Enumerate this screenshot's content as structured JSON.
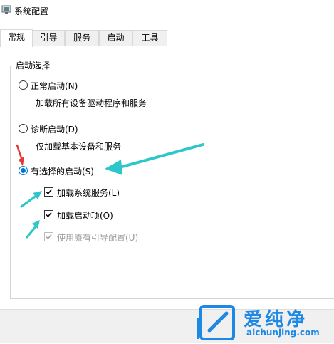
{
  "window": {
    "title": "系统配置",
    "icon": "msconfig-icon"
  },
  "tabs": [
    {
      "label": "常规",
      "active": true
    },
    {
      "label": "引导",
      "active": false
    },
    {
      "label": "服务",
      "active": false
    },
    {
      "label": "启动",
      "active": false
    },
    {
      "label": "工具",
      "active": false
    }
  ],
  "startup": {
    "group_label": "启动选择",
    "normal": {
      "label": "正常启动(N)",
      "desc": "加载所有设备驱动程序和服务",
      "selected": false
    },
    "diagnostic": {
      "label": "诊断启动(D)",
      "desc": "仅加载基本设备和服务",
      "selected": false
    },
    "selective": {
      "label": "有选择的启动(S)",
      "selected": true,
      "load_services": {
        "label": "加载系统服务(L)",
        "checked": true
      },
      "load_startup": {
        "label": "加载启动项(O)",
        "checked": true
      },
      "use_original_boot": {
        "label": "使用原有引导配置(U)",
        "checked": true,
        "disabled": true
      }
    }
  },
  "watermark": {
    "brand": "爱纯净",
    "url": "aichunjing.com"
  },
  "colors": {
    "accent": "#0078d7",
    "arrow_cyan": "#2ec7c9",
    "arrow_red": "#e53935",
    "disabled": "#9a9a9a"
  }
}
